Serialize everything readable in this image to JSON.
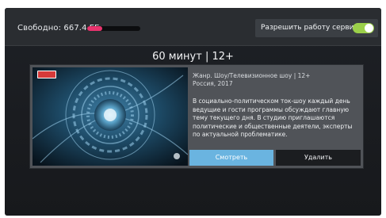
{
  "storage": {
    "free_label": "Свободно: 667.4 ГБ",
    "used_fraction": 0.28,
    "bar_color": "#e8336d"
  },
  "service": {
    "label": "Разрешить работу сервиса",
    "toggle_on": true,
    "toggle_color": "#9bd04a"
  },
  "program": {
    "duration_rating": "60 минут | 12+",
    "genre_line": "Жанр. Шоу/Телевизионное шоу | 12+",
    "country_year": "Россия, 2017",
    "description_lines": [
      "В социально-политическом ток-шоу каждый день",
      "ведущие и гости программы обсуждают главную",
      "тему текущего дня. В студию приглашаются",
      "политические и общественные деятели, эксперты",
      "по актуальной проблематике."
    ],
    "channel_logo_color": "#d63a3a"
  },
  "actions": {
    "watch_label": "Смотреть",
    "delete_label": "Удалить",
    "watch_color": "#6ab4e0"
  }
}
